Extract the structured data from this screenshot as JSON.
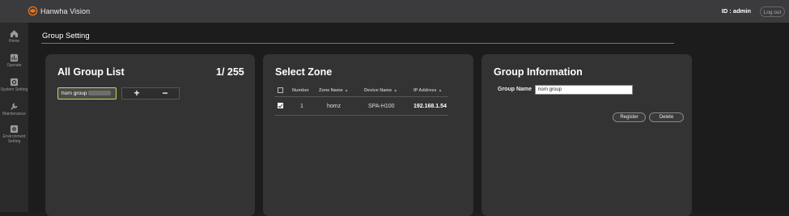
{
  "header": {
    "brand": "Hanwha Vision",
    "user_id": "ID : admin",
    "logout_label": "Log out"
  },
  "sidebar": {
    "items": [
      {
        "label": "Home",
        "icon": "home-icon"
      },
      {
        "label": "Operate",
        "icon": "operate-icon"
      },
      {
        "label": "System Setting",
        "icon": "system-setting-icon"
      },
      {
        "label": "Maintenance",
        "icon": "maintenance-icon"
      },
      {
        "label": "Environment Setting",
        "icon": "environment-setting-icon"
      }
    ]
  },
  "page": {
    "title": "Group Setting"
  },
  "all_group_list": {
    "title": "All Group List",
    "count": "1/ 255",
    "groups": [
      {
        "name": "horn group"
      }
    ],
    "add_symbol": "+",
    "remove_symbol": "−"
  },
  "select_zone": {
    "title": "Select Zone",
    "columns": [
      "Number",
      "Zone Name",
      "Device Name",
      "IP Address"
    ],
    "rows": [
      {
        "checked": true,
        "number": "1",
        "zone_name": "homz",
        "device_name": "SPA-H100",
        "ip_address": "192.168.1.54"
      }
    ]
  },
  "group_information": {
    "title": "Group Information",
    "group_name_label": "Group Name",
    "group_name_value": "horn group",
    "register_label": "Register",
    "delete_label": "Delete"
  },
  "colors": {
    "selected_chip_border": "#d6d24a",
    "logo_accent": "#e8731e"
  }
}
